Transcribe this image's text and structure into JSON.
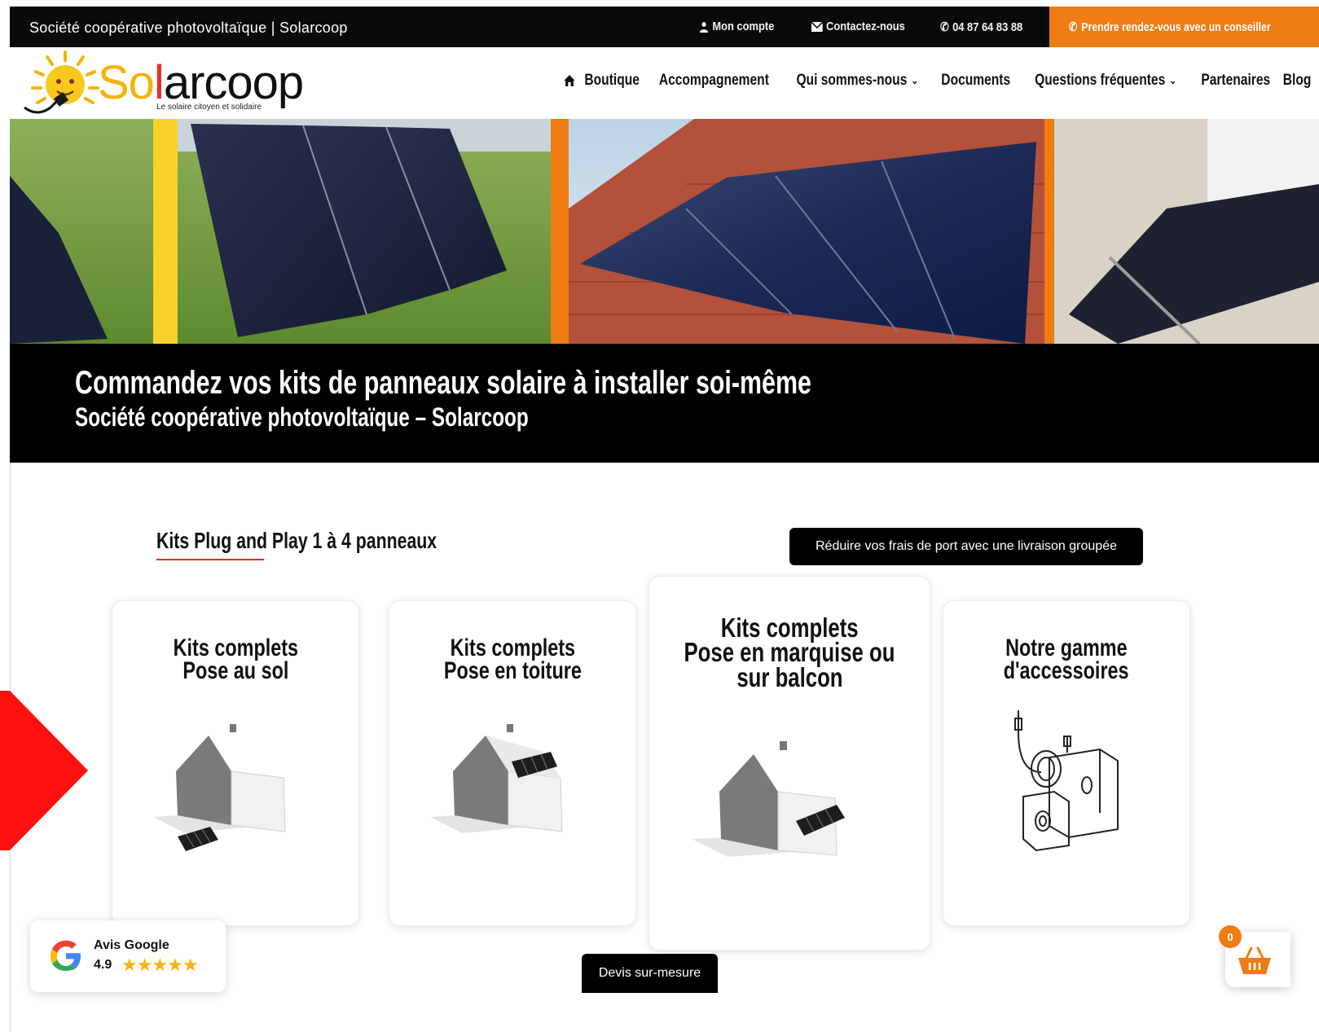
{
  "topbar": {
    "site_title": "Société coopérative photovoltaïque | Solarcoop",
    "account_label": "Mon compte",
    "contact_label": "Contactez-nous",
    "phone": "04 87 64 83 88",
    "cta_label": "Prendre rendez-vous avec un conseiller"
  },
  "logo": {
    "name": "Solarcoop",
    "tagline": "Le solaire citoyen et solidaire"
  },
  "nav": {
    "items": [
      {
        "label": "Boutique"
      },
      {
        "label": "Accompagnement"
      },
      {
        "label": "Qui sommes-nous"
      },
      {
        "label": "Documents"
      },
      {
        "label": "Questions fréquentes"
      },
      {
        "label": "Partenaires"
      },
      {
        "label": "Blog"
      }
    ]
  },
  "hero": {
    "title": "Commandez vos kits de panneaux solaire à installer soi-même",
    "subtitle": "Société coopérative photovoltaïque – Solarcoop"
  },
  "section": {
    "title": "Kits Plug and Play 1 à 4 panneaux",
    "shipping_button": "Réduire vos frais de port avec une livraison groupée"
  },
  "cards": [
    {
      "line1": "Kits complets",
      "line2": "Pose au sol"
    },
    {
      "line1": "Kits complets",
      "line2": "Pose en toiture"
    },
    {
      "line1": "Kits complets",
      "line2": "Pose en marquise ou",
      "line3": "sur balcon"
    },
    {
      "line1": "Notre gamme",
      "line2": "d'accessoires"
    }
  ],
  "google": {
    "label": "Avis Google",
    "rating": "4.9",
    "stars": "★★★★★"
  },
  "devis_button": "Devis sur-mesure",
  "cart": {
    "count": "0",
    "accent": "#f07c14"
  },
  "colors": {
    "accent_orange": "#f07c14",
    "logo_yellow": "#f3b400",
    "underline_red": "#e02a2a"
  }
}
